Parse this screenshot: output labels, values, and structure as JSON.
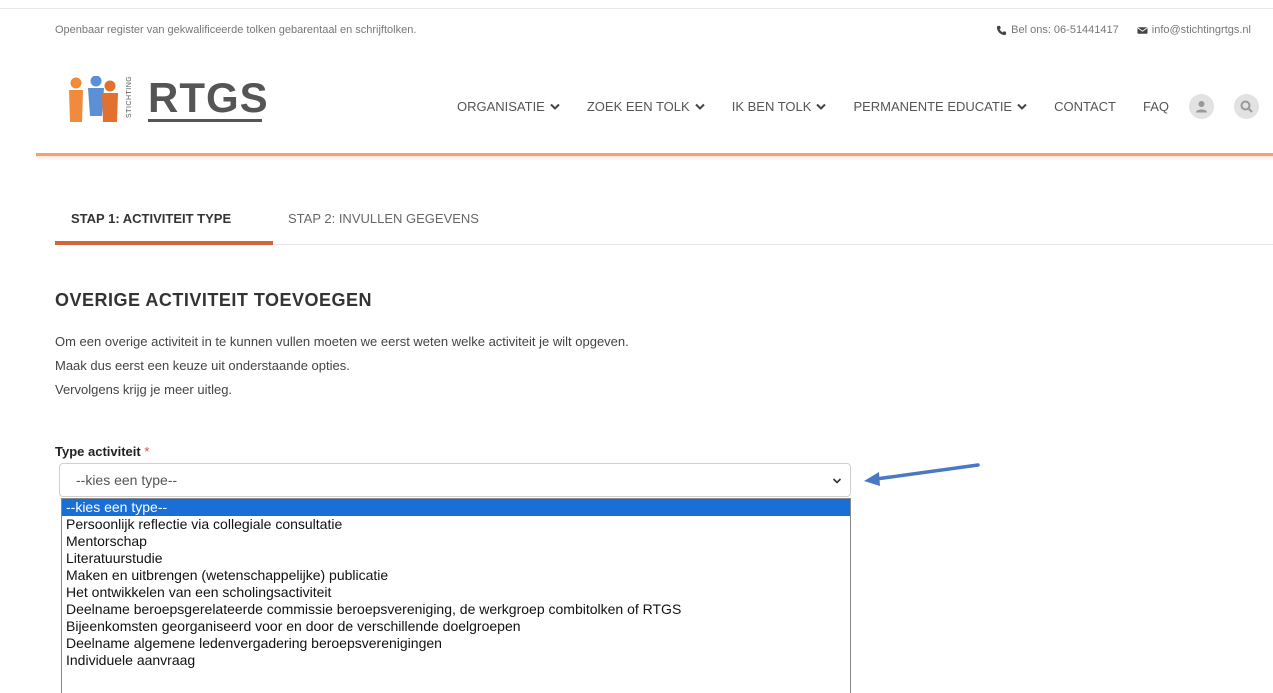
{
  "topbar": {
    "tagline": "Openbaar register van gekwalificeerde tolken gebarentaal en schrijftolken.",
    "phone_label": "Bel ons: 06-51441417",
    "email_label": "info@stichtingrtgs.nl"
  },
  "logo": {
    "text": "RTGS",
    "subtext": "STICHTING",
    "colors": [
      "#f08a3c",
      "#5b8fd6",
      "#e27130"
    ]
  },
  "nav": {
    "items": [
      {
        "label": "ORGANISATIE",
        "has_dropdown": true
      },
      {
        "label": "ZOEK EEN TOLK",
        "has_dropdown": true
      },
      {
        "label": "IK BEN TOLK",
        "has_dropdown": true
      },
      {
        "label": "PERMANENTE EDUCATIE",
        "has_dropdown": true
      },
      {
        "label": "CONTACT",
        "has_dropdown": false
      },
      {
        "label": "FAQ",
        "has_dropdown": false
      }
    ],
    "icons": [
      "user-icon",
      "search-icon"
    ]
  },
  "tabs": [
    {
      "label": "STAP 1: ACTIVITEIT TYPE",
      "active": true
    },
    {
      "label": "STAP 2: INVULLEN GEGEVENS",
      "active": false
    }
  ],
  "main": {
    "title": "OVERIGE ACTIVITEIT TOEVOEGEN",
    "intro_lines": [
      "Om een overige activiteit in te kunnen vullen moeten we eerst weten welke activiteit je wilt opgeven.",
      "Maak dus eerst een keuze uit onderstaande opties.",
      "Vervolgens krijg je meer uitleg."
    ]
  },
  "form": {
    "type_label": "Type activiteit",
    "required_marker": "*",
    "selected_value": "--kies een type--",
    "options": [
      "--kies een type--",
      "Persoonlijk reflectie via collegiale consultatie",
      "Mentorschap",
      "Literatuurstudie",
      "Maken en uitbrengen (wetenschappelijke) publicatie",
      "Het ontwikkelen van een scholingsactiviteit",
      "Deelname beroepsgerelateerde commissie beroepsvereniging, de werkgroep combitolken of RTGS",
      "Bijeenkomsten georganiseerd voor en door de verschillende doelgroepen",
      "Deelname algemene ledenvergadering beroepsverenigingen",
      "Individuele aanvraag"
    ],
    "highlighted_index": 0
  },
  "colors": {
    "accent": "#d4653a",
    "header_line": "#f0a27a",
    "selected_option": "#1a6fd6",
    "annotation_arrow": "#4a78c2"
  }
}
